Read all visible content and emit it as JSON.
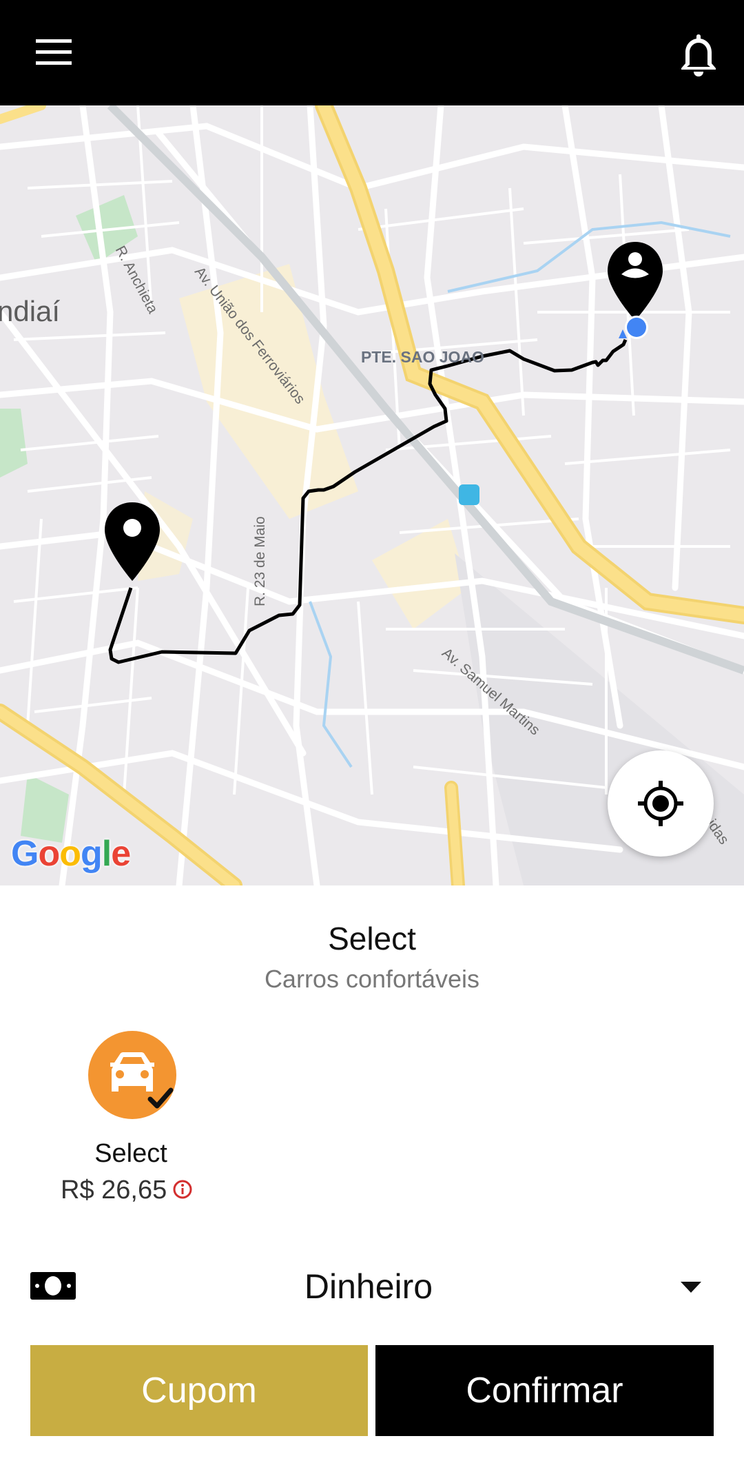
{
  "colors": {
    "topbar": "#000000",
    "accent_gold": "#c8ad42",
    "vehicle_orange": "#f39531",
    "route": "#000000",
    "user_dot": "#4285F4",
    "info_red": "#d32f2f"
  },
  "topbar": {
    "menu_icon": "hamburger-menu-icon",
    "notification_icon": "bell-icon"
  },
  "map": {
    "city_label": "ndiaí",
    "street_labels": {
      "uniao": "Av. União dos Ferroviários",
      "anchieta": "R. Anchieta",
      "sao_joao": "PTE. SAO JOAO",
      "maio": "R. 23 de Maio",
      "samuel": "Av. Samuel Martins",
      "unidas": "Unidas"
    },
    "attribution": [
      "G",
      "o",
      "o",
      "g",
      "l",
      "e"
    ],
    "locate_icon": "crosshair-icon"
  },
  "sheet": {
    "title": "Select",
    "subtitle": "Carros confortáveis"
  },
  "vehicle": {
    "icon": "car-icon",
    "name": "Select",
    "price": "R$ 26,65",
    "selected": true
  },
  "payment": {
    "icon": "cash-icon",
    "method": "Dinheiro"
  },
  "buttons": {
    "cupom": "Cupom",
    "confirmar": "Confirmar"
  }
}
